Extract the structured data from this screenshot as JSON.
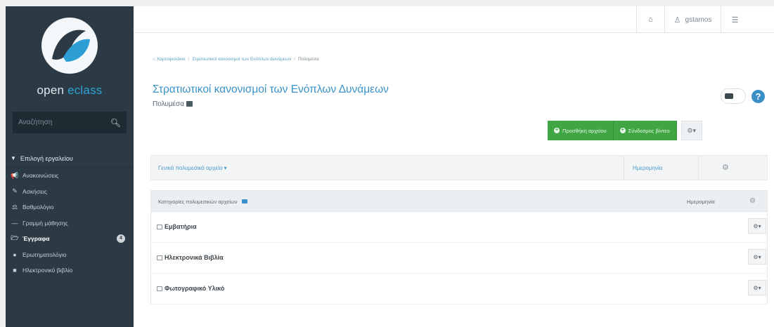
{
  "sidebar": {
    "brand_prefix": "open ",
    "brand_accent": "eclass",
    "search_placeholder": "Αναζήτηση",
    "tools_header": "Επιλογή εργαλείου",
    "items": [
      {
        "label": "Ανακοινώσεις",
        "icon": "megaphone-icon",
        "glyph": "📢"
      },
      {
        "label": "Ασκήσεις",
        "icon": "edit-icon",
        "glyph": "✎"
      },
      {
        "label": "Βαθμολόγιο",
        "icon": "gradebook-icon",
        "glyph": "⚖"
      },
      {
        "label": "Γραμμή μάθησης",
        "icon": "path-icon",
        "glyph": "—"
      },
      {
        "label": "Έγγραφα",
        "icon": "folder-icon",
        "glyph": "🗁",
        "badge": "4",
        "active": true
      },
      {
        "label": "Ερωτηματολόγιο",
        "icon": "question-icon",
        "glyph": "●"
      },
      {
        "label": "Ηλεκτρονικό βιβλίο",
        "icon": "book-icon",
        "glyph": "■"
      }
    ]
  },
  "topbar": {
    "username": "gstamos"
  },
  "breadcrumb": {
    "items": [
      "Χαρτοφυλάκιο",
      "Στρατιωτικοί κανονισμοί των Ενόπλων Δυνάμεων",
      "Πολυμέσα"
    ]
  },
  "page": {
    "title": "Στρατιωτικοί κανονισμοί των Ενόπλων Δυνάμεων",
    "subtitle": "Πολυμέσα"
  },
  "actions": {
    "add_file": "Προσθήκη αρχείου",
    "add_link": "Σύνδεσμος βίντεο"
  },
  "general_panel": {
    "title": "Γενικά πολυμεσικά αρχεία ▾",
    "date": "Ημερομηνία"
  },
  "categories_panel": {
    "header": "Κατηγορίες πολυμεσικών αρχείων",
    "date_header": "Ημερομηνία",
    "rows": [
      {
        "name": "Εμβατήρια"
      },
      {
        "name": "Ηλεκτρονικά Βιβλία"
      },
      {
        "name": "Φωτογραφικό Υλικό"
      }
    ]
  },
  "colors": {
    "sidebar_bg": "#2b3a44",
    "accent_blue": "#3a92c9",
    "green": "#3fa643"
  }
}
